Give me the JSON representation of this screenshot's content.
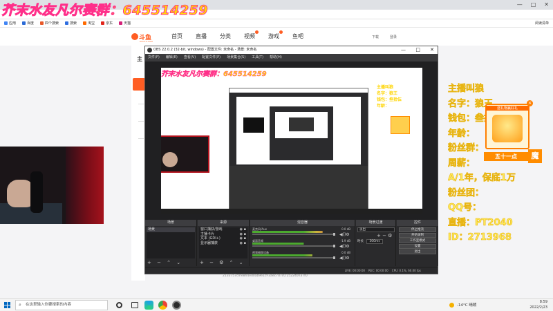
{
  "overlay": {
    "title": "芥末水友凡尔赛群：645514259",
    "right_lines": [
      "主播叫狼",
      "名字：狼王",
      "钱包：叁拾伍",
      "年龄：",
      "粉丝群：",
      "周薪：",
      "A/1年，保底1万",
      "粉丝团：",
      "QQ号：",
      "直播：PT2040",
      "ID：2713968"
    ],
    "gift_title": "送礼物赢好礼",
    "gift_button": "五十一点",
    "gift_badge": "魔",
    "gift_close": "×"
  },
  "browser": {
    "bookmarks": [
      "应用",
      "百度",
      "四个搜索",
      "搜索",
      "淘宝",
      "京东",
      "天猫"
    ],
    "read_mode": "阅读清单",
    "window_controls": [
      "—",
      "□",
      "✕"
    ]
  },
  "site": {
    "logo_text": "斗鱼",
    "logo_sub": "DOUYU.COM",
    "nav": [
      "首页",
      "直播",
      "分类",
      "视频",
      "游戏",
      "鱼吧"
    ],
    "header_right": [
      "下载",
      "登录"
    ],
    "side_label": "主"
  },
  "obs": {
    "title": "OBS 22.0.2 (32-bit, windows) - 配置文件: 未命名 - 场景: 未命名",
    "window_controls": [
      "—",
      "□",
      "✕"
    ],
    "menu": [
      "文件(F)",
      "编辑(E)",
      "查看(V)",
      "配置文件(P)",
      "场景集合(S)",
      "工具(T)",
      "帮助(H)"
    ],
    "preview_title": "芥末水友凡尔赛群：645514259",
    "preview_right_text": [
      "主播叫狼",
      "名字：狼王",
      "钱包：叁拾伍",
      "年龄："
    ],
    "docks": {
      "scenes": {
        "title": "场景",
        "items": [
          "场景"
        ]
      },
      "sources": {
        "title": "来源",
        "items": [
          "窗口捕获/游戏",
          "主播卡片",
          "文本 (GDI+)",
          "显示器捕获"
        ]
      },
      "mixer": {
        "title": "混音器",
        "tracks": [
          {
            "name": "麦克风/Aux",
            "db": "0.0 dB",
            "level": 0.82
          },
          {
            "name": "桌面音频",
            "db": "-1.9 dB",
            "level": 0.6
          },
          {
            "name": "视频捕获设备",
            "db": "0.0 dB",
            "level": 0.7
          }
        ]
      },
      "transitions": {
        "title": "场景过渡",
        "selected": "淡出",
        "duration_label": "时长",
        "duration": "300ms"
      },
      "controls": {
        "title": "控件",
        "buttons": [
          "停止推流",
          "开始录制",
          "工作室模式",
          "设置",
          "退出"
        ]
      }
    },
    "status": "LIVE: 00:00:00    REC: 00:00:00    CPU: 0.1%, 60.00 fps"
  },
  "below_obs_text": "2133757cme8h4ed0ab9e1cf-3aec7d7c0.252240n37f0",
  "taskbar": {
    "search_placeholder": "在这里输入你要搜索的内容",
    "weather": "-14°C 晴朗",
    "time": "8:59",
    "date": "2022/2/23"
  }
}
